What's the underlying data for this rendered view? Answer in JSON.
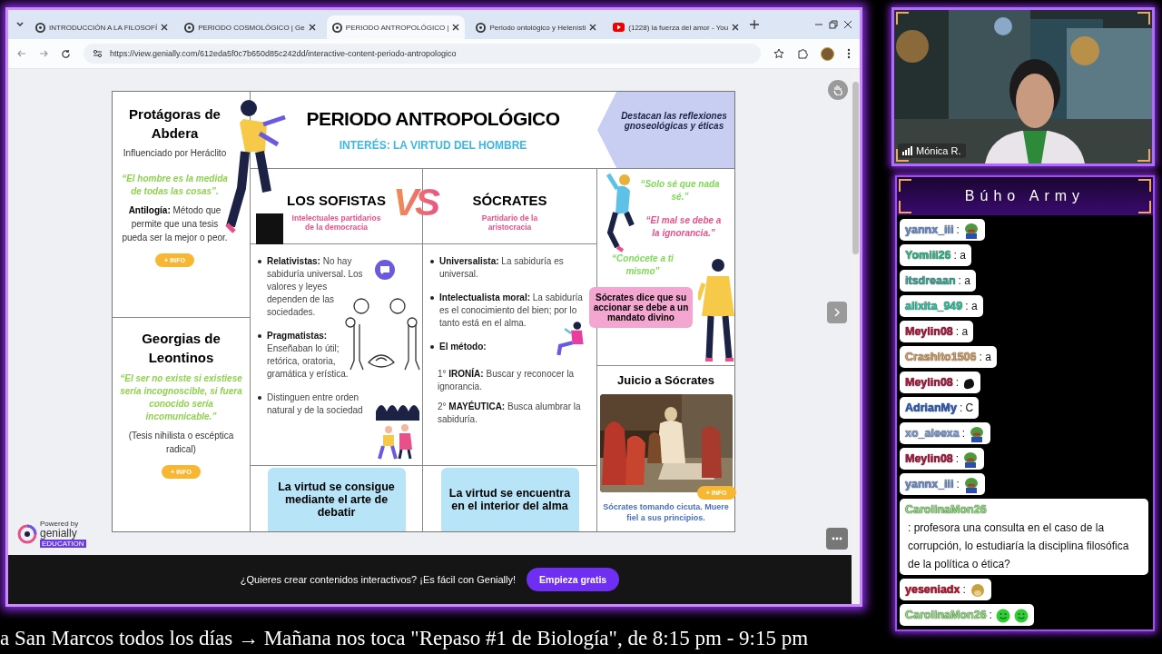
{
  "browser": {
    "tabs": [
      {
        "title": "INTRODUCCIÓN A LA FILOSOFÍ",
        "kind": "genially",
        "selected": false
      },
      {
        "title": "PERIODO COSMOLÓGICO | Ge",
        "kind": "genially",
        "selected": false
      },
      {
        "title": "PERIODO ANTROPOLÓGICO |",
        "kind": "genially",
        "selected": true
      },
      {
        "title": "Periodo ontológico y Helenísti",
        "kind": "genially",
        "selected": false
      },
      {
        "title": "(1228) la fuerza del amor - You",
        "kind": "video",
        "selected": false
      }
    ],
    "address": "https://view.genially.com/612eda5f0c7b650d85c242dd/interactive-content-periodo-antropologico"
  },
  "slide": {
    "title": "PERIODO ANTROPOLÓGICO",
    "subtitle": "INTERÉS: LA VIRTUD DEL HOMBRE",
    "banner": "Destacan las reflexiones gnoseológicas y éticas",
    "thinkers": [
      {
        "name": "Protágoras de Abdera",
        "influence": "Influenciado por Heráclito",
        "quote": "“El hombre es la medida de todas las cosas”.",
        "definition": "**Antilogía:** Método que permite que una tesis pueda ser la mejor o peor.",
        "button": "+ INFO"
      },
      {
        "name": "Georgias de Leontinos",
        "quote": "“El ser no existe si existiese sería incognoscible, si fuera conocido sería incomunicable.”",
        "note": "(Tesis nihilista o escéptica radical)",
        "button": "+ INFO"
      }
    ],
    "vs": "VS",
    "sides": [
      {
        "heading": "LOS SOFISTAS",
        "subheading": "Intelectuales partidarios de la democracia",
        "points": [
          {
            "kind": "item",
            "text": "**Relativistas:** No hay sabiduría universal. Los valores y leyes dependen de las sociedades."
          },
          {
            "kind": "item",
            "text": "**Pragmatistas:** Enseñaban lo útil; retórica, oratoria, gramática y erística."
          },
          {
            "kind": "item",
            "text": "Distinguen entre orden natural y de la sociedad"
          }
        ],
        "conclusion": "La virtud se consigue mediante el arte de debatir"
      },
      {
        "heading": "SÓCRATES",
        "subheading": "Partidario de la aristocracia",
        "points": [
          {
            "kind": "item",
            "text": "**Universalista:** La sabiduría es universal."
          },
          {
            "kind": "item",
            "text": "**Intelectualista moral:** La sabiduría es el conocimiento del bien; por lo tanto está en el alma."
          },
          {
            "kind": "heading",
            "text": "El método:",
            "children": [
              {
                "text": "1° **IRONÍA:** Buscar y reconocer la ignorancia."
              },
              {
                "text": "2° **MAYÉUTICA:** Busca alumbrar la sabiduría."
              }
            ]
          }
        ],
        "conclusion": "La virtud se encuentra en el interior del alma"
      }
    ],
    "quotes": [
      {
        "text": "“Solo sé que nada sé.”",
        "color": "#7ed957"
      },
      {
        "text": "“El mal se debe a la ignorancia.”",
        "color": "#e8508a"
      },
      {
        "text": "“Conócete a ti mismo”",
        "color": "#7ed957"
      }
    ],
    "callout": "Sócrates dice que su accionar se debe a un mandato divino",
    "trial": {
      "title": "Juicio a Sócrates",
      "caption": "Sócrates tomando cicuta. Muere fiel a sus principios.",
      "button": "+ INFO"
    }
  },
  "branding": {
    "top": "Powered by",
    "name": "genially",
    "badge": "EDUCATION"
  },
  "promo": {
    "text": "¿Quieres crear contenidos interactivos? ¡Es fácil con Genially!",
    "button": "Empieza gratis"
  },
  "ticker": "a San Marcos todos los días  →  Mañana nos toca \"Repaso #1 de Biología\", de 8:15 pm - 9:15 pm",
  "webcam": {
    "name": "Mónica R."
  },
  "chat": {
    "title": "Búho Army",
    "messages": [
      {
        "user": "yannx_iii",
        "color": "#6a8fd0",
        "text": ":",
        "emotes": [
          {
            "kind": "frog"
          }
        ]
      },
      {
        "user": "Yomiii26",
        "color": "#2dbf8a",
        "text": ": a"
      },
      {
        "user": "itsdreaan",
        "color": "#3aa89a",
        "text": ": a"
      },
      {
        "user": "alixita_949",
        "color": "#2cc7a0",
        "text": ": a"
      },
      {
        "user": "Meylin08",
        "color": "#b0143c",
        "text": ": a"
      },
      {
        "user": "Crashito1506",
        "color": "#d8a060",
        "text": ": a"
      },
      {
        "user": "Meylin08",
        "color": "#b0143c",
        "text": ":",
        "emotes": [
          {
            "kind": "blob"
          }
        ]
      },
      {
        "user": "AdrianMy",
        "color": "#2a5fc0",
        "text": ": C"
      },
      {
        "user": "xo_aleexa",
        "color": "#7f9fd8",
        "text": ":",
        "emotes": [
          {
            "kind": "frog"
          }
        ]
      },
      {
        "user": "Meylin08",
        "color": "#b0143c",
        "text": ":",
        "emotes": [
          {
            "kind": "frog"
          }
        ]
      },
      {
        "user": "yannx_iii",
        "color": "#6a8fd0",
        "text": ":",
        "emotes": [
          {
            "kind": "frog"
          }
        ]
      },
      {
        "user": "CarolinaMon26",
        "color": "#8de07a",
        "text": ": profesora una consulta en el caso de la corrupción, lo estudiaría la disciplina filosófica de la política o ética?"
      },
      {
        "user": "yeseniadx",
        "color": "#c0102e",
        "text": ":",
        "emotes": [
          {
            "kind": "hamster"
          }
        ]
      },
      {
        "user": "CarolinaMon26",
        "color": "#8de07a",
        "text": ":",
        "emotes": [
          {
            "kind": "smile"
          },
          {
            "kind": "smile"
          }
        ]
      }
    ]
  }
}
